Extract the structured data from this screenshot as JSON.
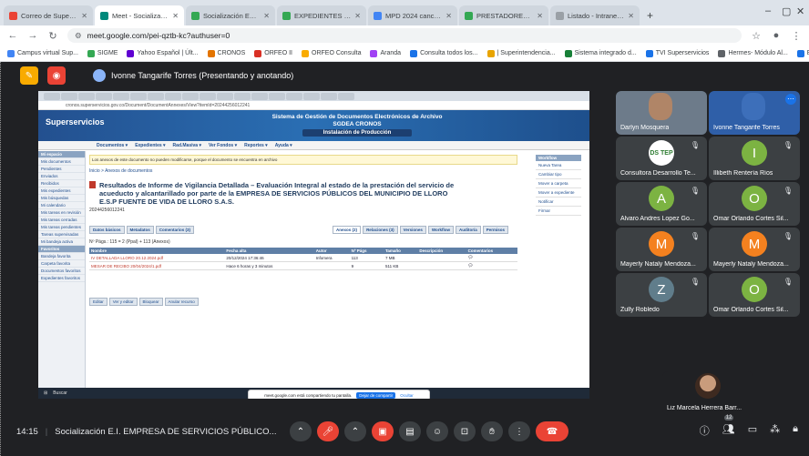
{
  "browser": {
    "tabs": [
      {
        "label": "Correo de Superintendencia de",
        "color": "#ea4335",
        "active": false
      },
      {
        "label": "Meet - Socialización E.I. EM",
        "color": "#00897b",
        "active": true
      },
      {
        "label": "Socialización EMPRESA DE SER",
        "color": "#34a853",
        "active": false
      },
      {
        "label": "EXPEDIENTES 420 (13).xlsx - Ho",
        "color": "#34a853",
        "active": false
      },
      {
        "label": "MPD 2024 cancelación de ofic",
        "color": "#4285f4",
        "active": false
      },
      {
        "label": "PRESTADORES ACU -NO TRATA",
        "color": "#34a853",
        "active": false
      },
      {
        "label": "Listado - Intranet SGDEA Supe",
        "color": "#9aa0a6",
        "active": false
      }
    ],
    "new_tab": "+",
    "url": "meet.google.com/pei-qztb-kc?authuser=0",
    "bookmarks": [
      "Campus virtual Sup...",
      "SIGME",
      "Yahoo Español | Últ...",
      "CRONOS",
      "ORFEO II",
      "ORFEO Consulta",
      "Aranda",
      "Consulta todos los...",
      "| Superintendencia...",
      "Sistema integrado d...",
      "TVI Superservicios",
      "Hermes- Módulo Al...",
      "EN VIVO ONLINE"
    ],
    "all_bookmarks": "Todos los favoritos"
  },
  "meet": {
    "presenter_label": "Ivonne Tangarife Torres (Presentando y anotando)",
    "meeting_time": "14:15",
    "meeting_title": "Socialización E.I. EMPRESA DE SERVICIOS PÚBLICO...",
    "participant_count": "12",
    "participants": [
      {
        "name": "Darlyn Mosquera",
        "type": "video"
      },
      {
        "name": "Ivonne Tangarife Torres",
        "type": "video"
      },
      {
        "name": "Consultora Desarrollo Te...",
        "type": "logo"
      },
      {
        "name": "Illibeth Rentería Ríos",
        "type": "avatar",
        "initial": "I",
        "color": "#7cb342"
      },
      {
        "name": "Alvaro Andres Lopez Go...",
        "type": "avatar",
        "initial": "A",
        "color": "#7cb342"
      },
      {
        "name": "Omar Orlando Cortes Sil...",
        "type": "avatar",
        "initial": "O",
        "color": "#7cb342"
      },
      {
        "name": "Mayerly Nataly Mendoza...",
        "type": "avatar",
        "initial": "M",
        "color": "#f4811f"
      },
      {
        "name": "Mayerly Nataly Mendoza...",
        "type": "avatar",
        "initial": "M",
        "color": "#f4811f"
      },
      {
        "name": "Zully Robledo",
        "type": "avatar",
        "initial": "Z",
        "color": "#607d8b"
      },
      {
        "name": "Omar Orlando Cortes Sil...",
        "type": "avatar",
        "initial": "O",
        "color": "#7cb342"
      },
      {
        "name": "Liz Marcela Herrera Barr...",
        "type": "photo"
      }
    ],
    "logo_text": "DS TEP"
  },
  "shared": {
    "org": "Superservicios",
    "system_title": "Sistema de Gestión de Documentos Electrónicos de Archivo",
    "system_subtitle": "SGDEA CRONOS",
    "env": "Instalación de Producción",
    "menu": [
      "Documentos ▾",
      "Expedientes ▾",
      "Rad.Masiva ▾",
      "Ver Fondos ▾",
      "Reportes ▾",
      "Ayuda ▾"
    ],
    "notice": "Los anexos de este documento no pueden modificarse, porque el documento se encuentra en archivo",
    "breadcrumb": "Inicio > Anexos de documentos",
    "doc_title": "Resultados de Informe de Vigilancia Detallada – Evaluación Integral al estado de la prestación del servicio de acueducto y alcantarillado por parte de la EMPRESA DE SERVICIOS PÚBLICOS DEL MUNICIPIO DE LLORO E.S.P FUENTE DE VIDA DE LLORO S.A.S.",
    "doc_number": "20244256012241",
    "pages_info": "Nº Págs.: 115 = 2 (Ppal) + 113 (Anexos)",
    "tabs": [
      "Datos básicos",
      "Metadatos",
      "Comentarios (3)",
      "Anexos (2)",
      "Relaciones (3)",
      "Versiones",
      "Workflow",
      "Auditoría",
      "Permisos"
    ],
    "table_headers": [
      "Nombre",
      "Fecha alta",
      "Autor",
      "Nº Págs",
      "Tamaño",
      "Descripción",
      "Comentarios"
    ],
    "rows": [
      {
        "name": "IV DETALLADA LLORO 20.12.2024.pdf",
        "date": "20/12/2024 17:36:46",
        "author": "Infomera",
        "pages": "113",
        "size": "7 MB"
      },
      {
        "name": "MESAR DE RECIBO 20/04/2024/1.pdf",
        "date": "Hace 6 horas y 3 minutos",
        "author": "",
        "pages": "9",
        "size": "511 KB"
      }
    ],
    "buttons": [
      "Editar",
      "Ver y editar",
      "Bloquear",
      "Anular recurso"
    ],
    "left_menu": [
      "Mi espacio",
      "Mis documentos",
      "Pendientes",
      "Enviados",
      "Recibidos",
      "Mis expedientes",
      "Mis búsquedas",
      "Mi calendario",
      "Mis tareas en revisión",
      "Mis tareas cerradas",
      "Mis tareas pendientes",
      "Tareas supervisadas",
      "Mi bandeja activa",
      "Favoritos",
      "Bandeja favorita",
      "Carpeta favorita",
      "Documentos favoritos",
      "Expedientes favoritos"
    ],
    "right_panel_title": "Workflow",
    "right_items": [
      "Nueva Tarea",
      "Cambiar tipo",
      "Mover a carpeta",
      "Mover a expediente",
      "Notificar",
      "Firmar"
    ],
    "share_notice": "meet.google.com está compartiendo tu pantalla.",
    "stop_share": "Dejar de compartir",
    "hide": "Ocultar",
    "search_taskbar": "Buscar"
  }
}
